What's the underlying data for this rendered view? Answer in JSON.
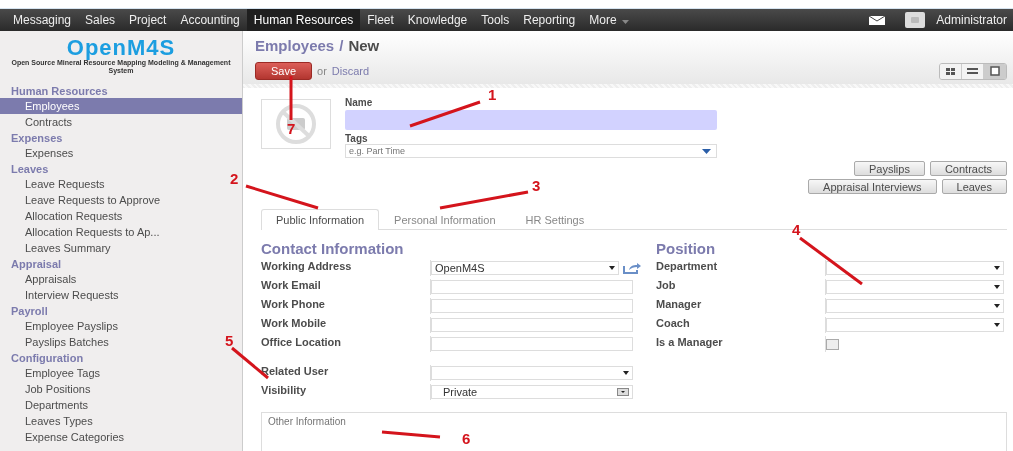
{
  "menu": [
    {
      "label": "Messaging",
      "selected": false
    },
    {
      "label": "Sales",
      "selected": false
    },
    {
      "label": "Project",
      "selected": false
    },
    {
      "label": "Accounting",
      "selected": false
    },
    {
      "label": "Human Resources",
      "selected": true
    },
    {
      "label": "Fleet",
      "selected": false
    },
    {
      "label": "Knowledge",
      "selected": false
    },
    {
      "label": "Tools",
      "selected": false
    },
    {
      "label": "Reporting",
      "selected": false
    },
    {
      "label": "More",
      "selected": false,
      "dropdown": true
    }
  ],
  "user": {
    "name": "Administrator"
  },
  "logo": {
    "title": "OpenM4S",
    "subtitle": "Open Source Mineral Resource Mapping Modeling & Management System"
  },
  "sidebar": {
    "sections": [
      {
        "title": "Human Resources",
        "items": [
          {
            "label": "Employees",
            "selected": true
          },
          {
            "label": "Contracts",
            "selected": false
          }
        ]
      },
      {
        "title": "Expenses",
        "items": [
          {
            "label": "Expenses",
            "selected": false
          }
        ]
      },
      {
        "title": "Leaves",
        "items": [
          {
            "label": "Leave Requests",
            "selected": false
          },
          {
            "label": "Leave Requests to Approve",
            "selected": false
          },
          {
            "label": "Allocation Requests",
            "selected": false
          },
          {
            "label": "Allocation Requests to Ap...",
            "selected": false
          },
          {
            "label": "Leaves Summary",
            "selected": false
          }
        ]
      },
      {
        "title": "Appraisal",
        "items": [
          {
            "label": "Appraisals",
            "selected": false
          },
          {
            "label": "Interview Requests",
            "selected": false
          }
        ]
      },
      {
        "title": "Payroll",
        "items": [
          {
            "label": "Employee Payslips",
            "selected": false
          },
          {
            "label": "Payslips Batches",
            "selected": false
          }
        ]
      },
      {
        "title": "Configuration",
        "items": [
          {
            "label": "Employee Tags",
            "selected": false
          },
          {
            "label": "Job Positions",
            "selected": false
          },
          {
            "label": "Departments",
            "selected": false
          },
          {
            "label": "Leaves Types",
            "selected": false
          },
          {
            "label": "Expense Categories",
            "selected": false
          }
        ]
      }
    ]
  },
  "breadcrumb": {
    "parent": "Employees",
    "separator": "/",
    "current": "New"
  },
  "actions": {
    "save": "Save",
    "or": "or",
    "discard": "Discard"
  },
  "views": [
    {
      "kind": "kanban",
      "selected": false
    },
    {
      "kind": "list",
      "selected": false
    },
    {
      "kind": "form",
      "selected": true
    }
  ],
  "form": {
    "name_label": "Name",
    "tags_label": "Tags",
    "tags_placeholder": "e.g. Part Time",
    "smart_buttons": [
      [
        "Payslips",
        "Contracts"
      ],
      [
        "Appraisal Interviews",
        "Leaves"
      ]
    ],
    "tabs": [
      {
        "label": "Public Information",
        "selected": true
      },
      {
        "label": "Personal Information",
        "selected": false
      },
      {
        "label": "HR Settings",
        "selected": false
      }
    ],
    "contact": {
      "title": "Contact Information",
      "fields": [
        {
          "label": "Working Address",
          "kind": "many2one",
          "value": "OpenM4S",
          "link": true
        },
        {
          "label": "Work Email",
          "kind": "text"
        },
        {
          "label": "Work Phone",
          "kind": "text"
        },
        {
          "label": "Work Mobile",
          "kind": "text"
        },
        {
          "label": "Office Location",
          "kind": "text"
        }
      ]
    },
    "user_fields": [
      {
        "label": "Related User",
        "kind": "many2one"
      },
      {
        "label": "Visibility",
        "kind": "select",
        "value": "Private"
      }
    ],
    "position": {
      "title": "Position",
      "fields": [
        {
          "label": "Department",
          "kind": "many2one"
        },
        {
          "label": "Job",
          "kind": "many2one"
        },
        {
          "label": "Manager",
          "kind": "many2one"
        },
        {
          "label": "Coach",
          "kind": "many2one"
        },
        {
          "label": "Is a Manager",
          "kind": "checkbox",
          "checked": false
        }
      ]
    },
    "notes_placeholder": "Other Information"
  },
  "annotations": [
    {
      "label": "1"
    },
    {
      "label": "2"
    },
    {
      "label": "3"
    },
    {
      "label": "4"
    },
    {
      "label": "5"
    },
    {
      "label": "6"
    },
    {
      "label": "7"
    }
  ]
}
